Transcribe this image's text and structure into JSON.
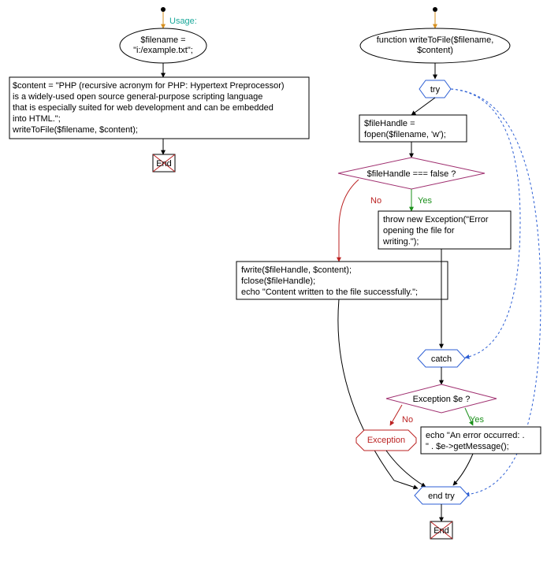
{
  "left": {
    "usage_label": "Usage:",
    "filename_box": {
      "l1": "$filename =",
      "l2": "\"i:/example.txt\";"
    },
    "content_box": {
      "l1": "$content = \"PHP (recursive acronym for PHP: Hypertext Preprocessor)",
      "l2": "is a widely-used open source general-purpose scripting language",
      "l3": "that is especially suited for web development and can be embedded",
      "l4": "into HTML.\";",
      "l5": "writeToFile($filename, $content);"
    },
    "end": "End"
  },
  "right": {
    "func_box": {
      "l1": "function writeToFile($filename,",
      "l2": "$content)"
    },
    "try_label": "try",
    "fopen_box": {
      "l1": "$fileHandle =",
      "l2": "fopen($filename, 'w');"
    },
    "cond1": "$fileHandle === false ?",
    "no1": "No",
    "yes1": "Yes",
    "throw_box": {
      "l1": "throw new Exception(\"Error",
      "l2": "opening the file for",
      "l3": "writing.\");"
    },
    "fwrite_box": {
      "l1": "fwrite($fileHandle, $content);",
      "l2": "fclose($fileHandle);",
      "l3": "echo \"Content written to the file successfully.\";"
    },
    "catch_label": "catch",
    "cond2": "Exception $e ?",
    "no2": "No",
    "yes2": "Yes",
    "exception_label": "Exception",
    "echo_box": {
      "l1": "echo \"An error occurred: .",
      "l2": "\" . $e->getMessage();"
    },
    "endtry_label": "end try",
    "end": "End"
  }
}
